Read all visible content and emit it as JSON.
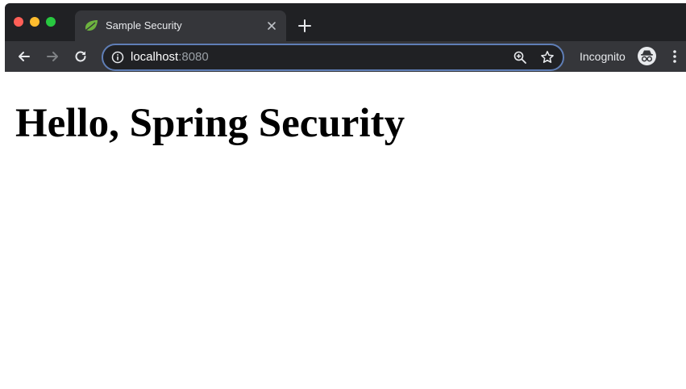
{
  "browser": {
    "tab": {
      "title": "Sample Security",
      "favicon": "spring-leaf-icon"
    },
    "omnibox": {
      "host": "localhost",
      "port": ":8080"
    },
    "profile_label": "Incognito"
  },
  "page": {
    "heading": "Hello, Spring Security"
  },
  "colors": {
    "tab_strip": "#202124",
    "toolbar": "#35363a",
    "omnibox_border": "#5f7eb6",
    "traffic_close": "#ff5f57",
    "traffic_minimize": "#febc2e",
    "traffic_zoom": "#28c840",
    "spring_green": "#6db33f"
  }
}
